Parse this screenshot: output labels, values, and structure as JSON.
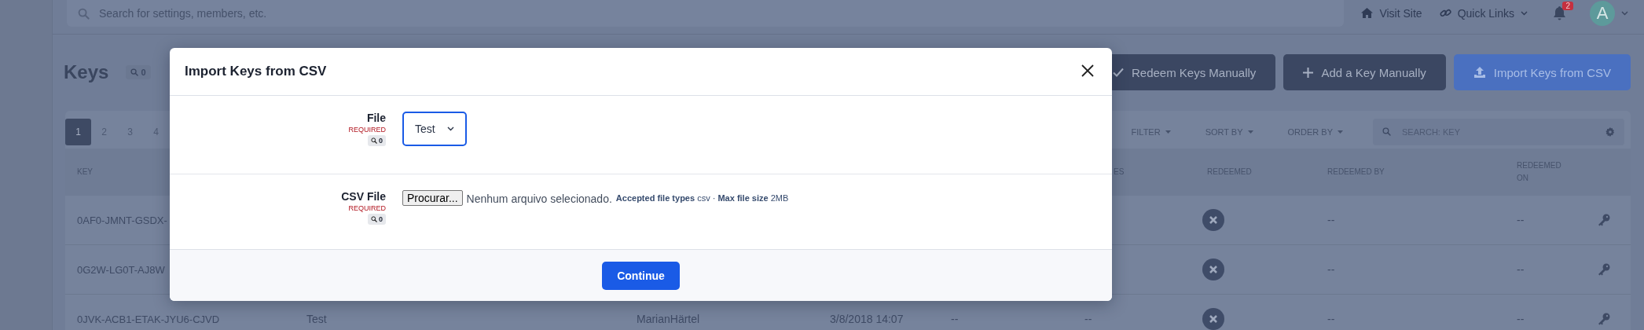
{
  "topbar": {
    "search": {
      "placeholder": "Search for settings, members, etc."
    },
    "links": [
      {
        "kind": "home",
        "label": "Visit Site"
      },
      {
        "kind": "chain",
        "label": "Quick Links"
      }
    ],
    "notifications": {
      "count": "2"
    },
    "avatar": {
      "initial": "A"
    }
  },
  "page": {
    "title": "Keys",
    "count": "0",
    "actions": [
      {
        "kind": "check",
        "label": "Redeem Keys Manually",
        "primary": false
      },
      {
        "kind": "plus",
        "label": "Add a Key Manually",
        "primary": false
      },
      {
        "kind": "upload",
        "label": "Import Keys from CSV",
        "primary": true
      }
    ]
  },
  "table": {
    "pages": [
      {
        "label": "1",
        "selected": true
      },
      {
        "label": "2",
        "selected": false
      },
      {
        "label": "3",
        "selected": false
      },
      {
        "label": "4",
        "selected": false
      }
    ],
    "toolbar": [
      "FILTER",
      "SORT BY",
      "ORDER BY"
    ],
    "search": {
      "placeholder": "SEARCH: KEY"
    },
    "columns": {
      "key": "KEY",
      "column_6": "ES",
      "redeemed": "REDEEMED",
      "redeemed_by": "REDEEMED BY",
      "redeemed_on": "REDEEMED ON"
    },
    "rows": [
      {
        "key": "0AF0-JMNT-GSDX-",
        "redeemed": false,
        "redeemed_by": "--",
        "redeemed_on": "--"
      },
      {
        "key": "0G2W-LG0T-AJ8W",
        "redeemed": false,
        "redeemed_by": "--",
        "redeemed_on": "--"
      },
      {
        "key": "0JVK-ACB1-ETAK-JYU6-CJVD",
        "column_2": "Test",
        "column_3": "MarianHärtel",
        "column_4": "3/8/2018 14:07",
        "column_5": "--",
        "column_6": "--",
        "redeemed": false,
        "redeemed_by": "--",
        "redeemed_on": "--"
      }
    ]
  },
  "modal": {
    "title": "Import Keys from CSV",
    "fields": [
      {
        "kind": "select",
        "label": "File",
        "required": "REQUIRED",
        "count": "0",
        "value": "Test"
      },
      {
        "kind": "file",
        "label": "CSV File",
        "required": "REQUIRED",
        "count": "0",
        "button": "Procurar...",
        "status": "Nenhum arquivo selecionado.",
        "hint": "**Accepted file types** csv · **Max file size** 2MB"
      }
    ],
    "submit": "Continue"
  }
}
